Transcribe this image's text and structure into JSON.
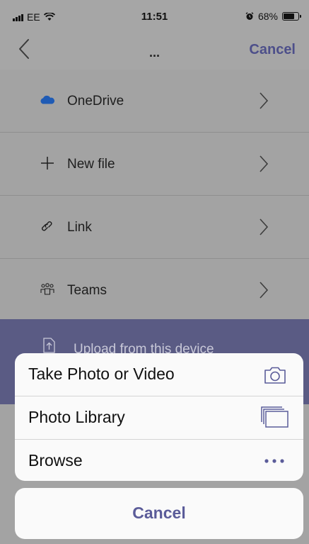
{
  "status_bar": {
    "carrier": "EE",
    "time": "11:51",
    "battery": "68%",
    "battery_level": 0.68
  },
  "nav": {
    "title": "...",
    "cancel_label": "Cancel"
  },
  "list": {
    "items": [
      {
        "label": "OneDrive",
        "icon": "onedrive-cloud-icon"
      },
      {
        "label": "New file",
        "icon": "plus-icon"
      },
      {
        "label": "Link",
        "icon": "link-icon"
      },
      {
        "label": "Teams",
        "icon": "teams-icon"
      }
    ],
    "upload_label": "Upload from this device"
  },
  "action_sheet": {
    "actions": [
      {
        "label": "Take Photo or Video",
        "icon": "camera-icon"
      },
      {
        "label": "Photo Library",
        "icon": "photo-library-icon"
      },
      {
        "label": "Browse",
        "icon": "more-icon"
      }
    ],
    "cancel_label": "Cancel"
  },
  "colors": {
    "accent": "#5b5c99",
    "dim_overlay": "#a3a3a3",
    "upload_bg": "#5a5b84"
  }
}
